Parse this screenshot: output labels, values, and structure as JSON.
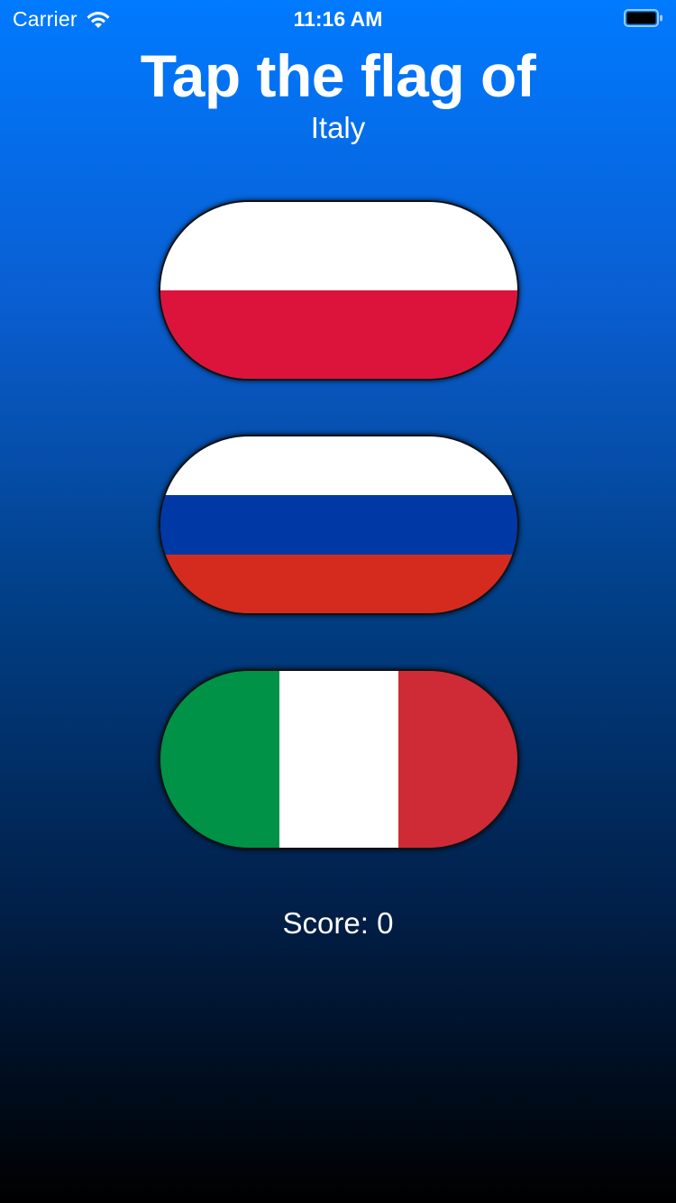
{
  "status_bar": {
    "carrier": "Carrier",
    "time": "11:16 AM",
    "wifi_icon": "wifi-icon",
    "battery_icon": "battery-icon"
  },
  "header": {
    "title": "Tap the flag of",
    "country": "Italy"
  },
  "flags": [
    {
      "name": "Poland",
      "layout": "horizontal",
      "colors": [
        "#ffffff",
        "#dc143c"
      ]
    },
    {
      "name": "Russia",
      "layout": "horizontal",
      "colors": [
        "#ffffff",
        "#0039a6",
        "#d52b1e"
      ]
    },
    {
      "name": "Italy",
      "layout": "vertical",
      "colors": [
        "#009246",
        "#ffffff",
        "#ce2b37"
      ]
    }
  ],
  "score": {
    "label": "Score: 0"
  },
  "theme": {
    "gradient_top": "#007aff",
    "gradient_bottom": "#000000"
  }
}
